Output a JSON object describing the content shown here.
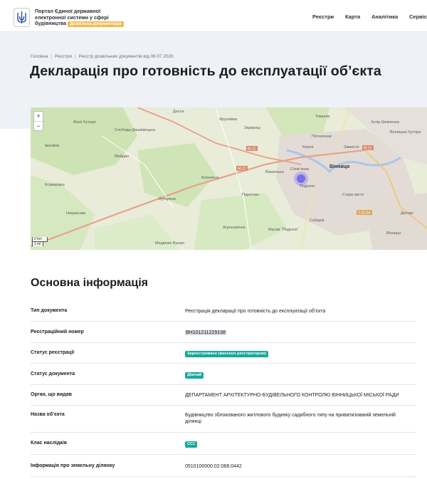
{
  "header": {
    "brand_line1": "Портал Єдиної державної",
    "brand_line2": "електронної системи у сфері",
    "brand_line3": "будівництва",
    "brand_badge": "Дозвільна документація",
    "nav": [
      "Реєстри",
      "Карта",
      "Аналітика",
      "Сервіс"
    ]
  },
  "breadcrumb": [
    "Головна",
    "Реєстри",
    "Реєстр дозвільних документів від 06.07.2020"
  ],
  "page_title": "Декларація про готовність до експлуатації об’єкта",
  "map": {
    "zoom_in": "+",
    "zoom_out": "−",
    "scale_km": "2 km",
    "scale_mi": "1 mi",
    "labels": [
      "Вінниця",
      "Слов’янка",
      "Вишенька",
      "Поділля",
      "Корея",
      "Замостя",
      "Старе місто",
      "Сабарів",
      "Масив \"Поділля\"",
      "Пирогово",
      "Агрономічне",
      "Березина",
      "Некрасове",
      "Майдан",
      "Слобода-Дашківецька",
      "Зарванці",
      "Фрунзівка",
      "Тяжилів",
      "Хутір Шевченка",
      "Вінницькі Хутори",
      "Медвеже Вушко",
      "Малі Хутори",
      "Десна",
      "Вінниця",
      "Іванівка",
      "Хуторяни",
      "Пятничани",
      "Діхтярі",
      "Ксаверівка"
    ],
    "road_labels": [
      "M-12",
      "M-21",
      "M-12",
      "T-02-04"
    ]
  },
  "section_title": "Основна інформація",
  "rows": [
    {
      "label": "Тип документа",
      "value": "Реєстрація декларації про готовність до експлуатації об’єкта"
    },
    {
      "label": "Реєстраційний номер",
      "value": "ВН101211229138"
    },
    {
      "label": "Статус реєстрації",
      "value": "Зареєстровано (внесено реєстратором)"
    },
    {
      "label": "Статус документа",
      "value": "Діючий"
    },
    {
      "label": "Орган, що видав",
      "value": "ДЕПАРТАМЕНТ АРХІТЕКТУРНО-БУДІВЕЛЬНОГО КОНТРОЛЮ ВІННИЦЬКОЇ МІСЬКОЇ РАДИ"
    },
    {
      "label": "Назва об’єкта",
      "value": "Будівництво зблокованого житлового будинку садибного типу на приватизованій земельній ділянці"
    },
    {
      "label": "Клас наслідків",
      "value": "СС1"
    },
    {
      "label": "Інформація про земельну ділянку",
      "value": "0510100000:02:068:0442"
    }
  ],
  "colors": {
    "hero_bg": "#eef1f5",
    "status_chip": "#16a89a",
    "badge": "#f3b84a",
    "map_road": "#e8a08a",
    "map_marker": "#7b6cf0"
  }
}
